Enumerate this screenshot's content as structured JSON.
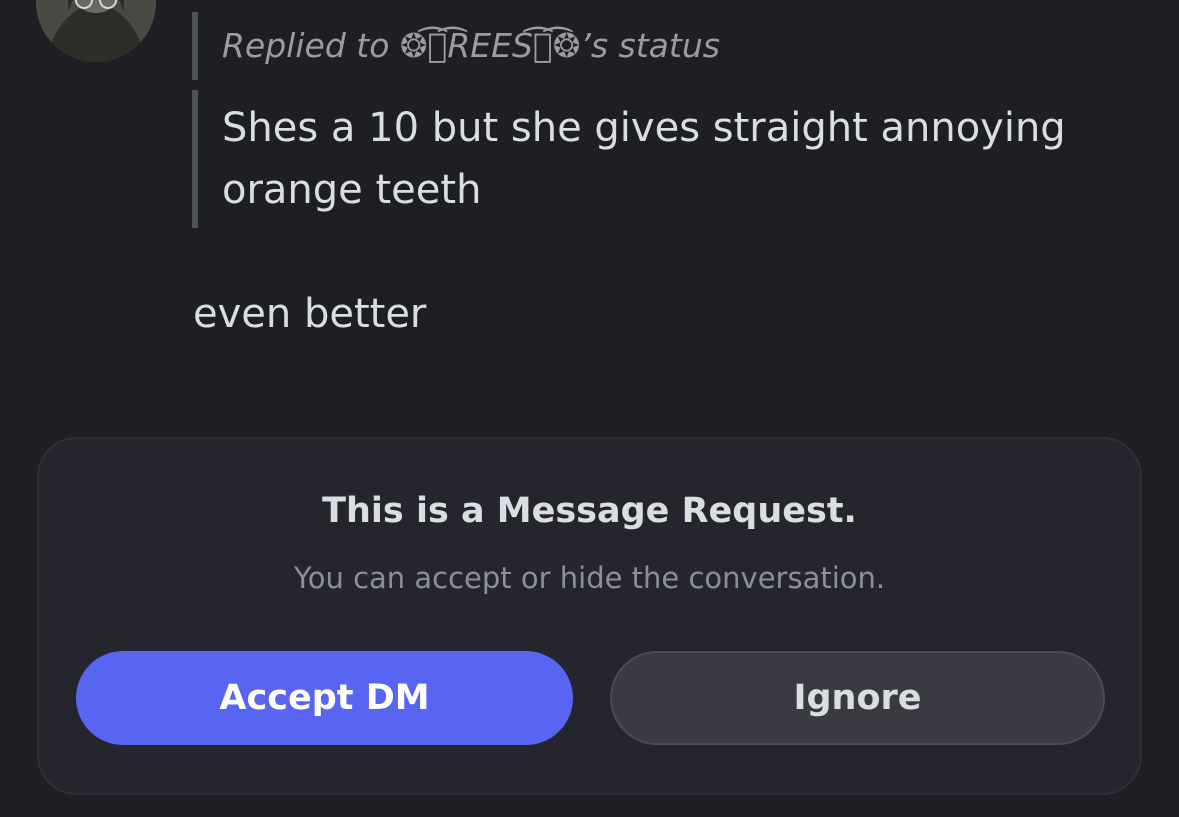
{
  "reply": {
    "header": "Replied to ❂͡👁͡REES͡👁͡❂’s status",
    "quote": "Shes a 10 but she gives straight annoying orange teeth"
  },
  "message": {
    "text": "even better"
  },
  "request": {
    "title": "This is a Message Request.",
    "subtitle": "You can accept or hide the conversation.",
    "accept_label": "Accept DM",
    "ignore_label": "Ignore"
  },
  "colors": {
    "background": "#1e1f24",
    "accent": "#5865f2",
    "card": "#25262d",
    "secondary_button": "#393a42"
  }
}
